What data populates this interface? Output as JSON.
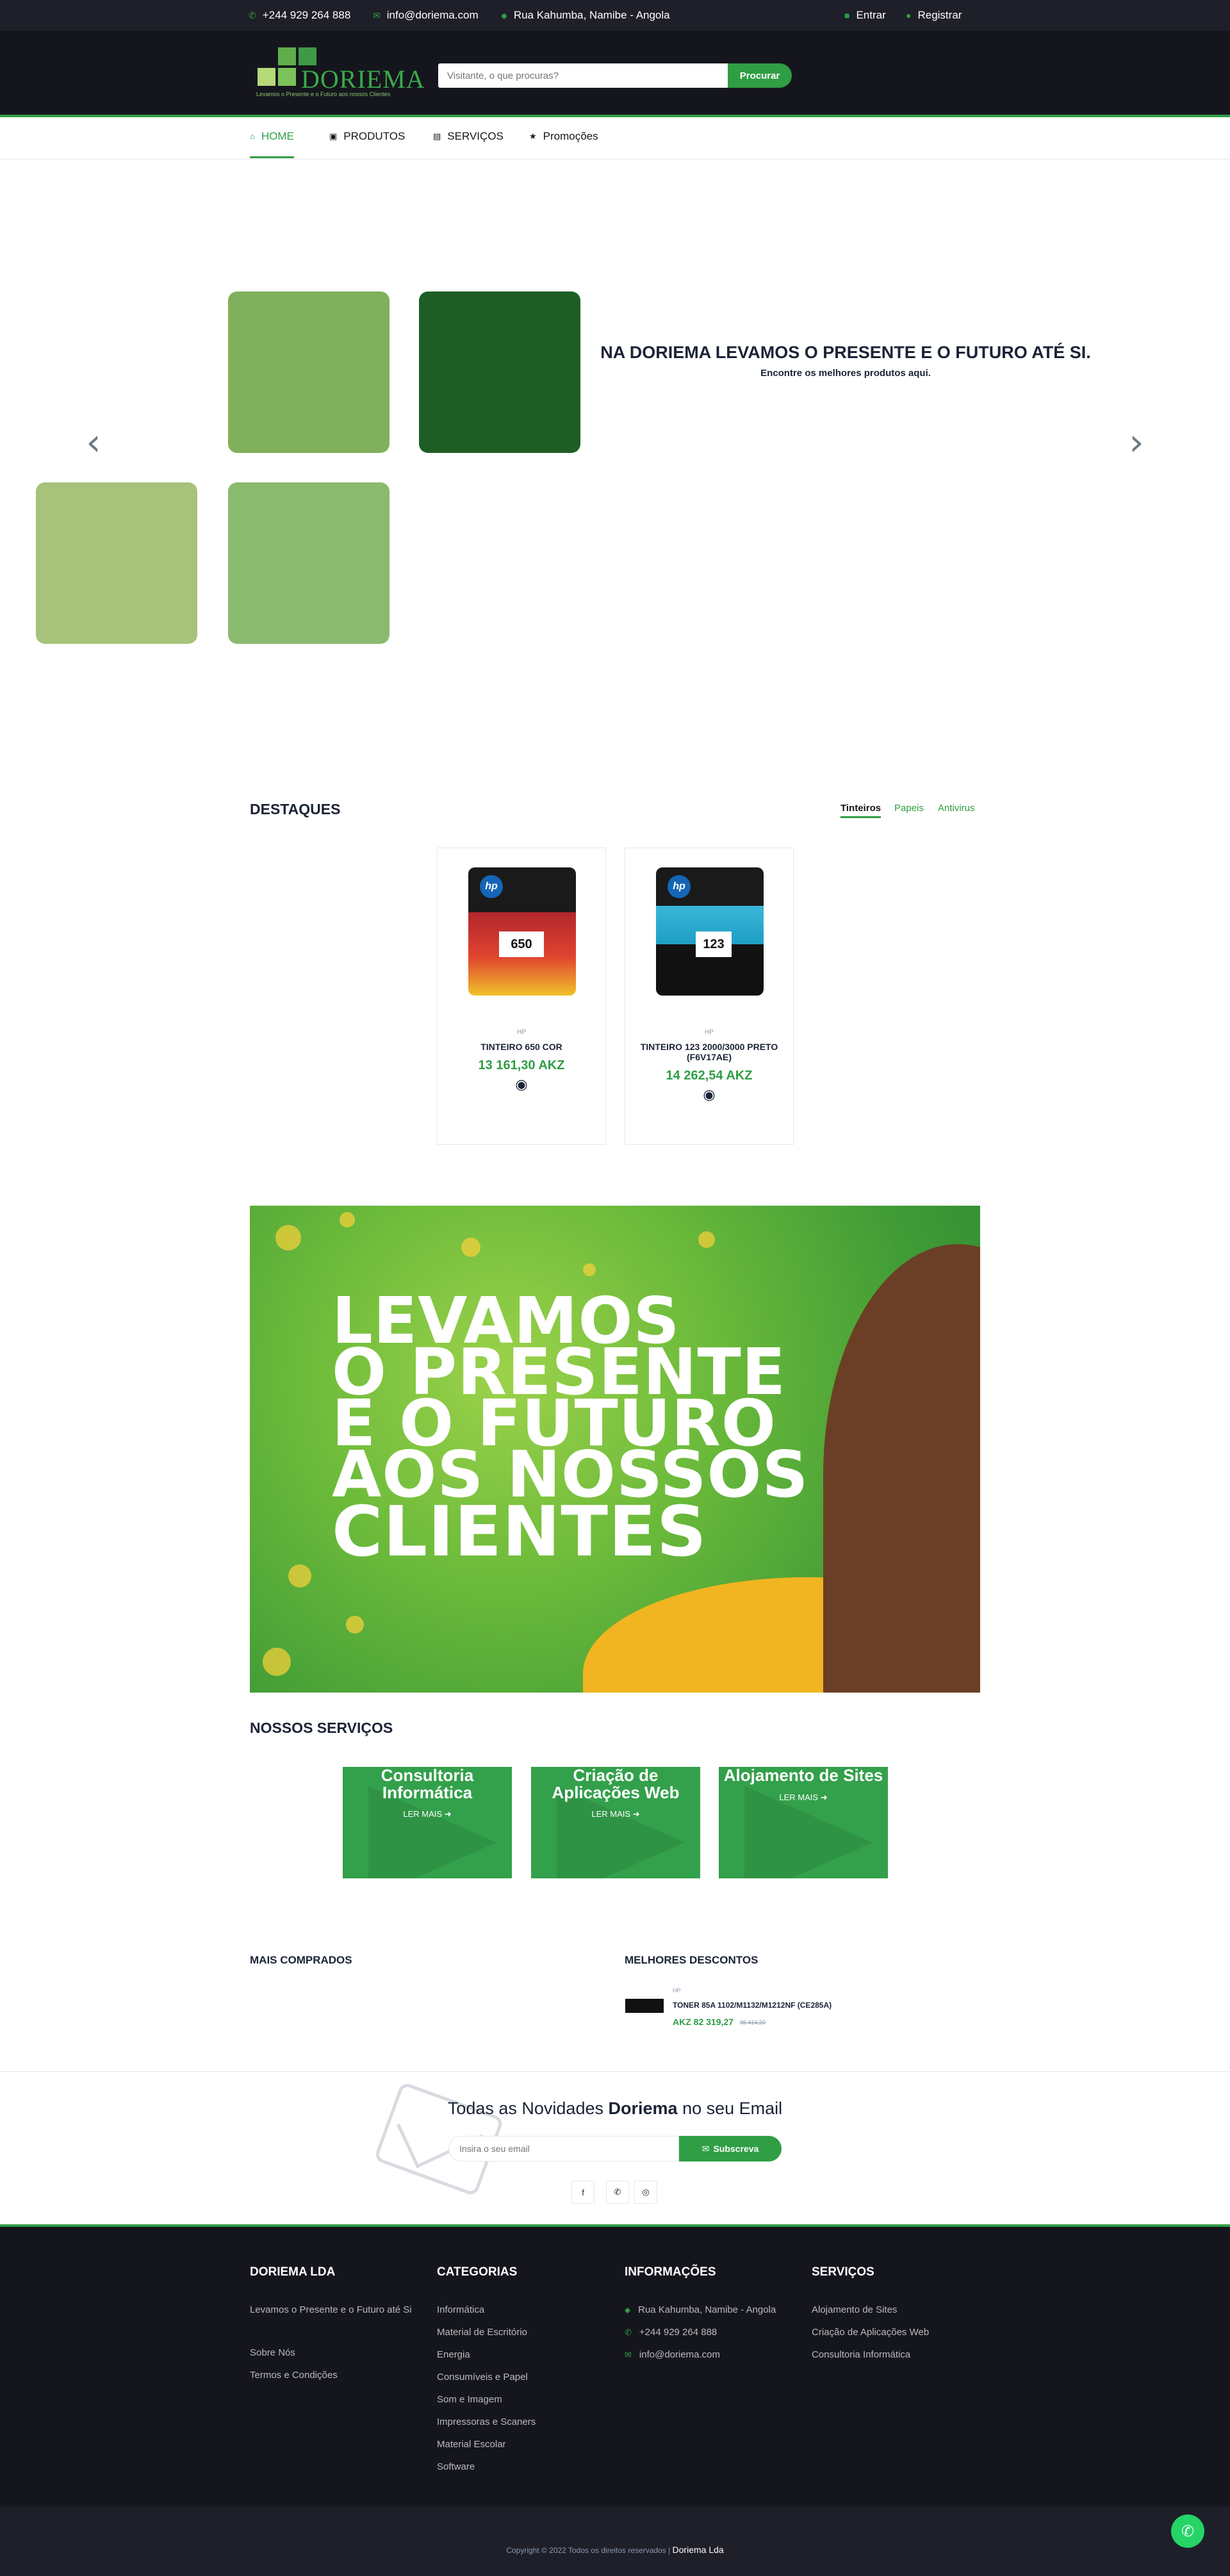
{
  "topbar": {
    "phone": "+244 929 264 888",
    "email": "info@doriema.com",
    "address": "Rua Kahumba, Namibe - Angola",
    "login": "Entrar",
    "register": "Registrar"
  },
  "header": {
    "logo_word": "DORIEMA",
    "logo_tagline": "Levamos o Presente e o Futuro aos nossos Clientes",
    "search_placeholder": "Visitante, o que procuras?",
    "search_button": "Procurar"
  },
  "nav": {
    "items": [
      {
        "label": "HOME",
        "icon": "home-icon",
        "active": true
      },
      {
        "label": "PRODUTOS",
        "icon": "cubes-icon",
        "active": false
      },
      {
        "label": "SERVIÇOS",
        "icon": "list-icon",
        "active": false
      },
      {
        "label": "Promoções",
        "icon": "star-icon",
        "active": false
      }
    ]
  },
  "hero": {
    "title": "NA DORIEMA LEVAMOS O PRESENTE E O FUTURO ATÉ SI.",
    "subtitle": "Encontre os melhores produtos aqui.",
    "tile_colors": [
      "#80b05c",
      "#1e5e25",
      "#a7c27a",
      "#8aba6e"
    ]
  },
  "destaques": {
    "title": "DESTAQUES",
    "tabs": [
      "Tinteiros",
      "Papeis",
      "Antivirus"
    ],
    "products": [
      {
        "brand": "HP",
        "name": "TINTEIRO 650 COR",
        "price": "13 161,30 AKZ",
        "box_label": "650"
      },
      {
        "brand": "HP",
        "name": "TINTEIRO 123 2000/3000 PRETO (F6V17AE)",
        "price": "14 262,54 AKZ",
        "box_label": "123"
      }
    ]
  },
  "banner": {
    "lines": [
      "LEVAMOS",
      "O PRESENTE",
      "E O FUTURO",
      "AOS NOSSOS",
      "CLIENTES"
    ]
  },
  "servicos": {
    "title": "NOSSOS SERVIÇOS",
    "items": [
      {
        "title": "Consultoria Informática",
        "more": "LER MAIS"
      },
      {
        "title": "Criação de Aplicações Web",
        "more": "LER MAIS"
      },
      {
        "title": "Alojamento de Sites",
        "more": "LER MAIS"
      }
    ]
  },
  "mais_comprados": {
    "title": "MAIS COMPRADOS"
  },
  "melhores_descontos": {
    "title": "MELHORES DESCONTOS",
    "item": {
      "brand": "HP",
      "name": "TONER 85A 1102/M1132/M1212NF (CE285A)",
      "price": "AKZ 82 319,27",
      "old_price": "95 414,20"
    }
  },
  "newsletter": {
    "title_before": "Todas as Novidades",
    "title_brand": "Doriema",
    "title_after": "no seu Email",
    "input_placeholder": "Insira o seu email",
    "button": "Subscreva"
  },
  "footer": {
    "col1": {
      "title": "DORIEMA LDA",
      "tagline": "Levamos o Presente e o Futuro até Si",
      "links": [
        "Sobre Nós",
        "Termos e Condições"
      ]
    },
    "col2": {
      "title": "CATEGORIAS",
      "links": [
        "Informática",
        "Material de Escritório",
        "Energia",
        "Consumíveis e Papel",
        "Som e Imagem",
        "Impressoras e Scaners",
        "Material Escolar",
        "Software"
      ]
    },
    "col3": {
      "title": "INFORMAÇÕES",
      "address": "Rua Kahumba, Namibe - Angola",
      "phone": "+244 929 264 888",
      "email": "info@doriema.com"
    },
    "col4": {
      "title": "SERVIÇOS",
      "links": [
        "Alojamento de Sites",
        "Criação de Aplicações Web",
        "Consultoria Informática"
      ]
    },
    "copyright": "Copyright © 2022 Todos os direitos reservados |",
    "copyright_brand": "Doriema Lda"
  },
  "colors": {
    "accent": "#2f9e44",
    "dark": "#15161d",
    "topbar": "#1e1f29"
  }
}
